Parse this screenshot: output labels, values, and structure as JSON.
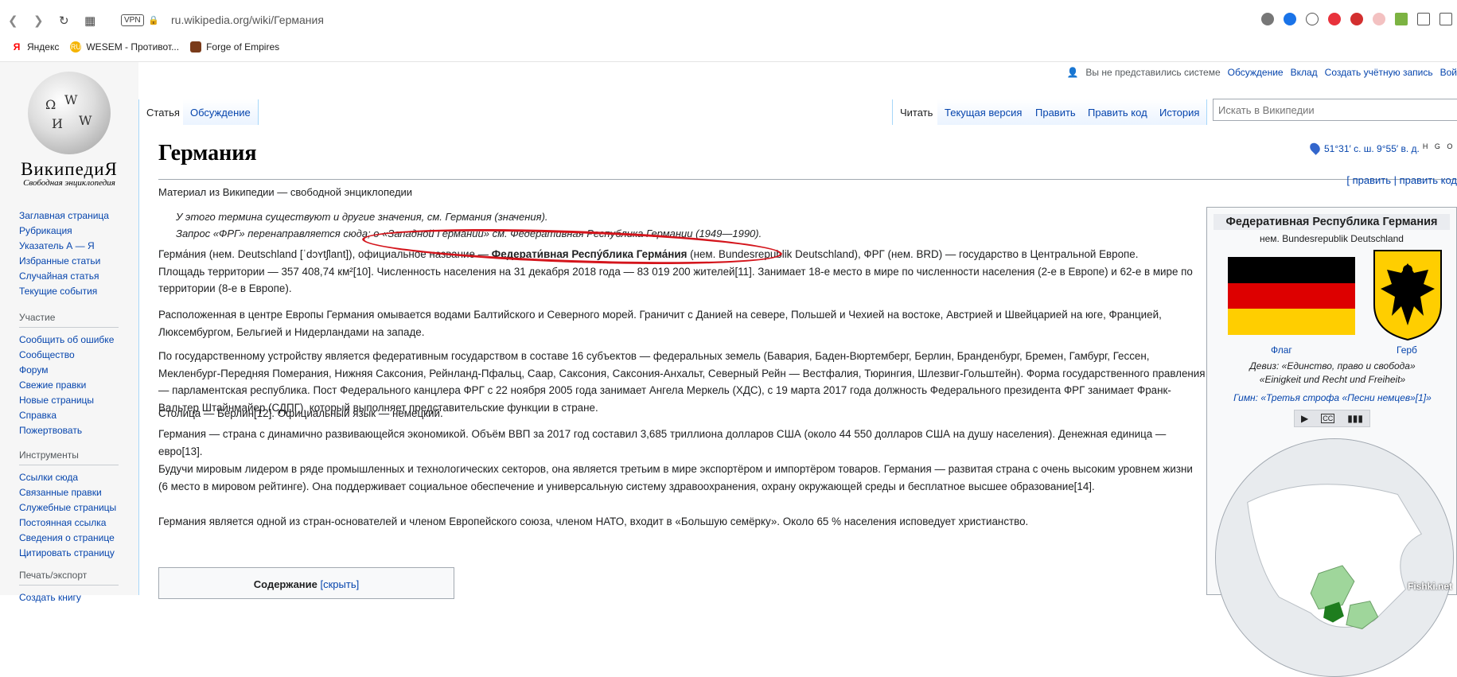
{
  "browser": {
    "url": "ru.wikipedia.org/wiki/Германия",
    "vpn": "VPN",
    "bookmarks": [
      {
        "label": "Яндекс",
        "icon": "yandex-icon"
      },
      {
        "label": "WESEM - Противот...",
        "icon": "wesem-icon"
      },
      {
        "label": "Forge of Empires",
        "icon": "forge-icon"
      }
    ]
  },
  "logo": {
    "wordmark": "ВикипедиЯ",
    "tagline": "Свободная энциклопедия"
  },
  "user": {
    "not_logged": "Вы не представились системе",
    "talk": "Обсуждение",
    "contributions": "Вклад",
    "create": "Создать учётную запись",
    "login": "Вой"
  },
  "nav": {
    "main": [
      "Заглавная страница",
      "Рубрикация",
      "Указатель А — Я",
      "Избранные статьи",
      "Случайная статья",
      "Текущие события"
    ],
    "participation_title": "Участие",
    "participation": [
      "Сообщить об ошибке",
      "Сообщество",
      "Форум",
      "Свежие правки",
      "Новые страницы",
      "Справка",
      "Пожертвовать"
    ],
    "tools_title": "Инструменты",
    "tools": [
      "Ссылки сюда",
      "Связанные правки",
      "Служебные страницы",
      "Постоянная ссылка",
      "Сведения о странице",
      "Цитировать страницу"
    ],
    "print_title": "Печать/экспорт",
    "print": [
      "Создать книгу"
    ]
  },
  "tabs": {
    "article": "Статья",
    "talk": "Обсуждение",
    "read": "Читать",
    "current": "Текущая версия",
    "edit": "Править",
    "edit_code": "Править код",
    "history": "История"
  },
  "search": {
    "placeholder": "Искать в Википедии"
  },
  "article": {
    "title": "Германия",
    "coords": "51°31′ с. ш. 9°55′ в. д.",
    "geo": "H G O",
    "from": "Материал из Википедии — свободной энциклопедии",
    "edit_links": "[ править | править код",
    "hat1": "У этого термина существуют и другие значения, см. Германия (значения).",
    "hat2": "Запрос «ФРГ» перенаправляется сюда; о «Западной Германии» см. Федеративная Республика Германии (1949—1990).",
    "p1a": "Герма́ния (нем. Deutschland [ˈdɔʏtʃlant]), официальное название — ",
    "p1b": "Федерати́вная Респу́блика Герма́ния",
    "p1c": " (нем. Bundesrepublik Deutschland), ФРГ (нем. BRD) — государство в Центральной Европе.",
    "p1d": "Площадь территории — 357 408,74 км²[10]. Численность населения на 31 декабря 2018 года — 83 019 200 жителей[11]. Занимает 18-е место в мире по численности населения (2-е в Европе) и 62-е в мире по территории (8-е в Европе).",
    "p2": "Расположенная в центре Европы Германия омывается водами Балтийского и Северного морей. Граничит с Данией на севере, Польшей и Чехией на востоке, Австрией и Швейцарией на юге, Францией, Люксембургом, Бельгией и Нидерландами на западе.",
    "p3": "По государственному устройству является федеративным государством в составе 16 субъектов — федеральных земель (Бавария, Баден-Вюртемберг, Берлин, Бранденбург, Бремен, Гамбург, Гессен, Мекленбург-Передняя Померания, Нижняя Саксония, Рейнланд-Пфальц, Саар, Саксония, Саксония-Анхальт, Северный Рейн — Вестфалия, Тюрингия, Шлезвиг-Гольштейн). Форма государственного правления — парламентская республика. Пост Федерального канцлера ФРГ с 22 ноября 2005 года занимает Ангела Меркель (ХДС), с 19 марта 2017 года должность Федерального президента ФРГ занимает Франк-Вальтер Штайнмайер (СДПГ), который выполняет представительские функции в стране.",
    "p4": "Столица — Берлин[12]. Официальный язык — немецкий.",
    "p5": "Германия — страна с динамично развивающейся экономикой. Объём ВВП за 2017 год составил 3,685 триллиона долларов США (около 44 550 долларов США на душу населения). Денежная единица — евро[13].",
    "p6": "Будучи мировым лидером в ряде промышленных и технологических секторов, она является третьим в мире экспортёром и импортёром товаров. Германия — развитая страна с очень высоким уровнем жизни (6 место в мировом рейтинге). Она поддерживает социальное обеспечение и универсальную систему здравоохранения, охрану окружающей среды и бесплатное высшее образование[14].",
    "p7": "Германия является одной из стран-основателей и членом Европейского союза, членом НАТО, входит в «Большую семёрку». Около 65 % населения исповедует христианство.",
    "toc_title": "Содержание",
    "toc_hide": "[скрыть]"
  },
  "infobox": {
    "title": "Федеративная Республика Германия",
    "subtitle": "нем. Bundesrepublik Deutschland",
    "flag": "Флаг",
    "coat": "Герб",
    "motto1": "Девиз: «Единство, право и свобода»",
    "motto2": "«Einigkeit und Recht und Freiheit»",
    "anthem": "Гимн: «Третья строфа «Песни немцев»[1]»",
    "flag_colors": [
      "#000000",
      "#dd0000",
      "#ffce00"
    ]
  },
  "watermark": "Fishki.net"
}
